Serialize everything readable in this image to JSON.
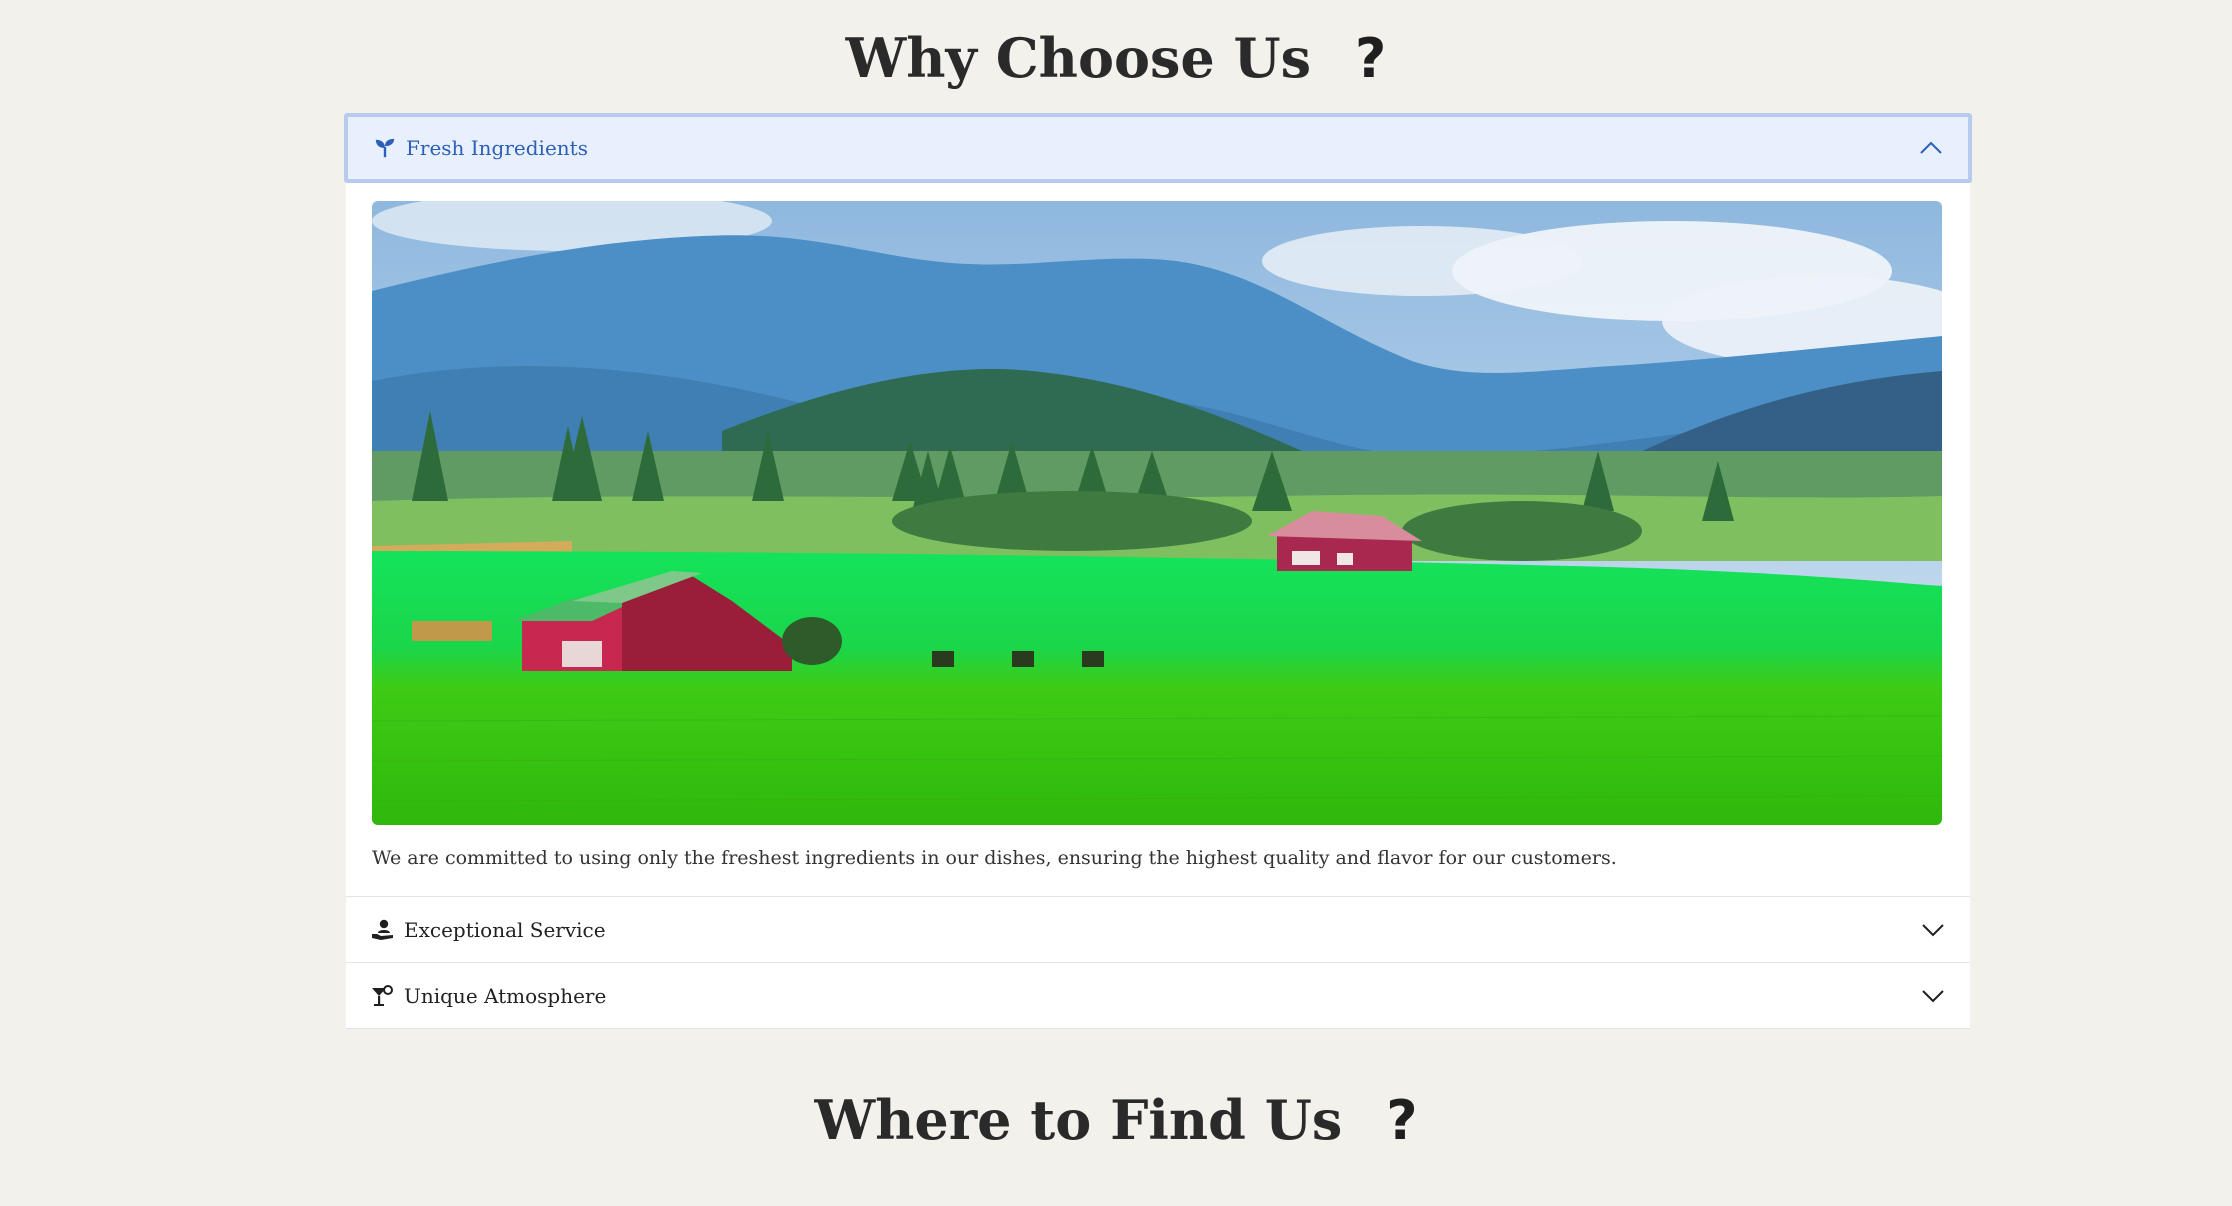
{
  "sections": {
    "why_title": "Why Choose Us",
    "why_qmark": "?",
    "where_title": "Where to Find Us",
    "where_qmark": "?"
  },
  "accordion": {
    "items": [
      {
        "label": "Fresh Ingredients",
        "icon": "seedling-icon",
        "expanded": true,
        "image": "farmland-landscape",
        "text": "We are committed to using only the freshest ingredients in our dishes, ensuring the highest quality and flavor for our customers."
      },
      {
        "label": "Exceptional Service",
        "icon": "hand-holding-person-icon",
        "expanded": false
      },
      {
        "label": "Unique Atmosphere",
        "icon": "cocktail-icon",
        "expanded": false
      }
    ]
  },
  "colors": {
    "page_background": "#f3f1ec",
    "active_header_bg": "#e8f0fe",
    "active_header_border": "#b7cbef",
    "active_text": "#2d5fb8"
  }
}
